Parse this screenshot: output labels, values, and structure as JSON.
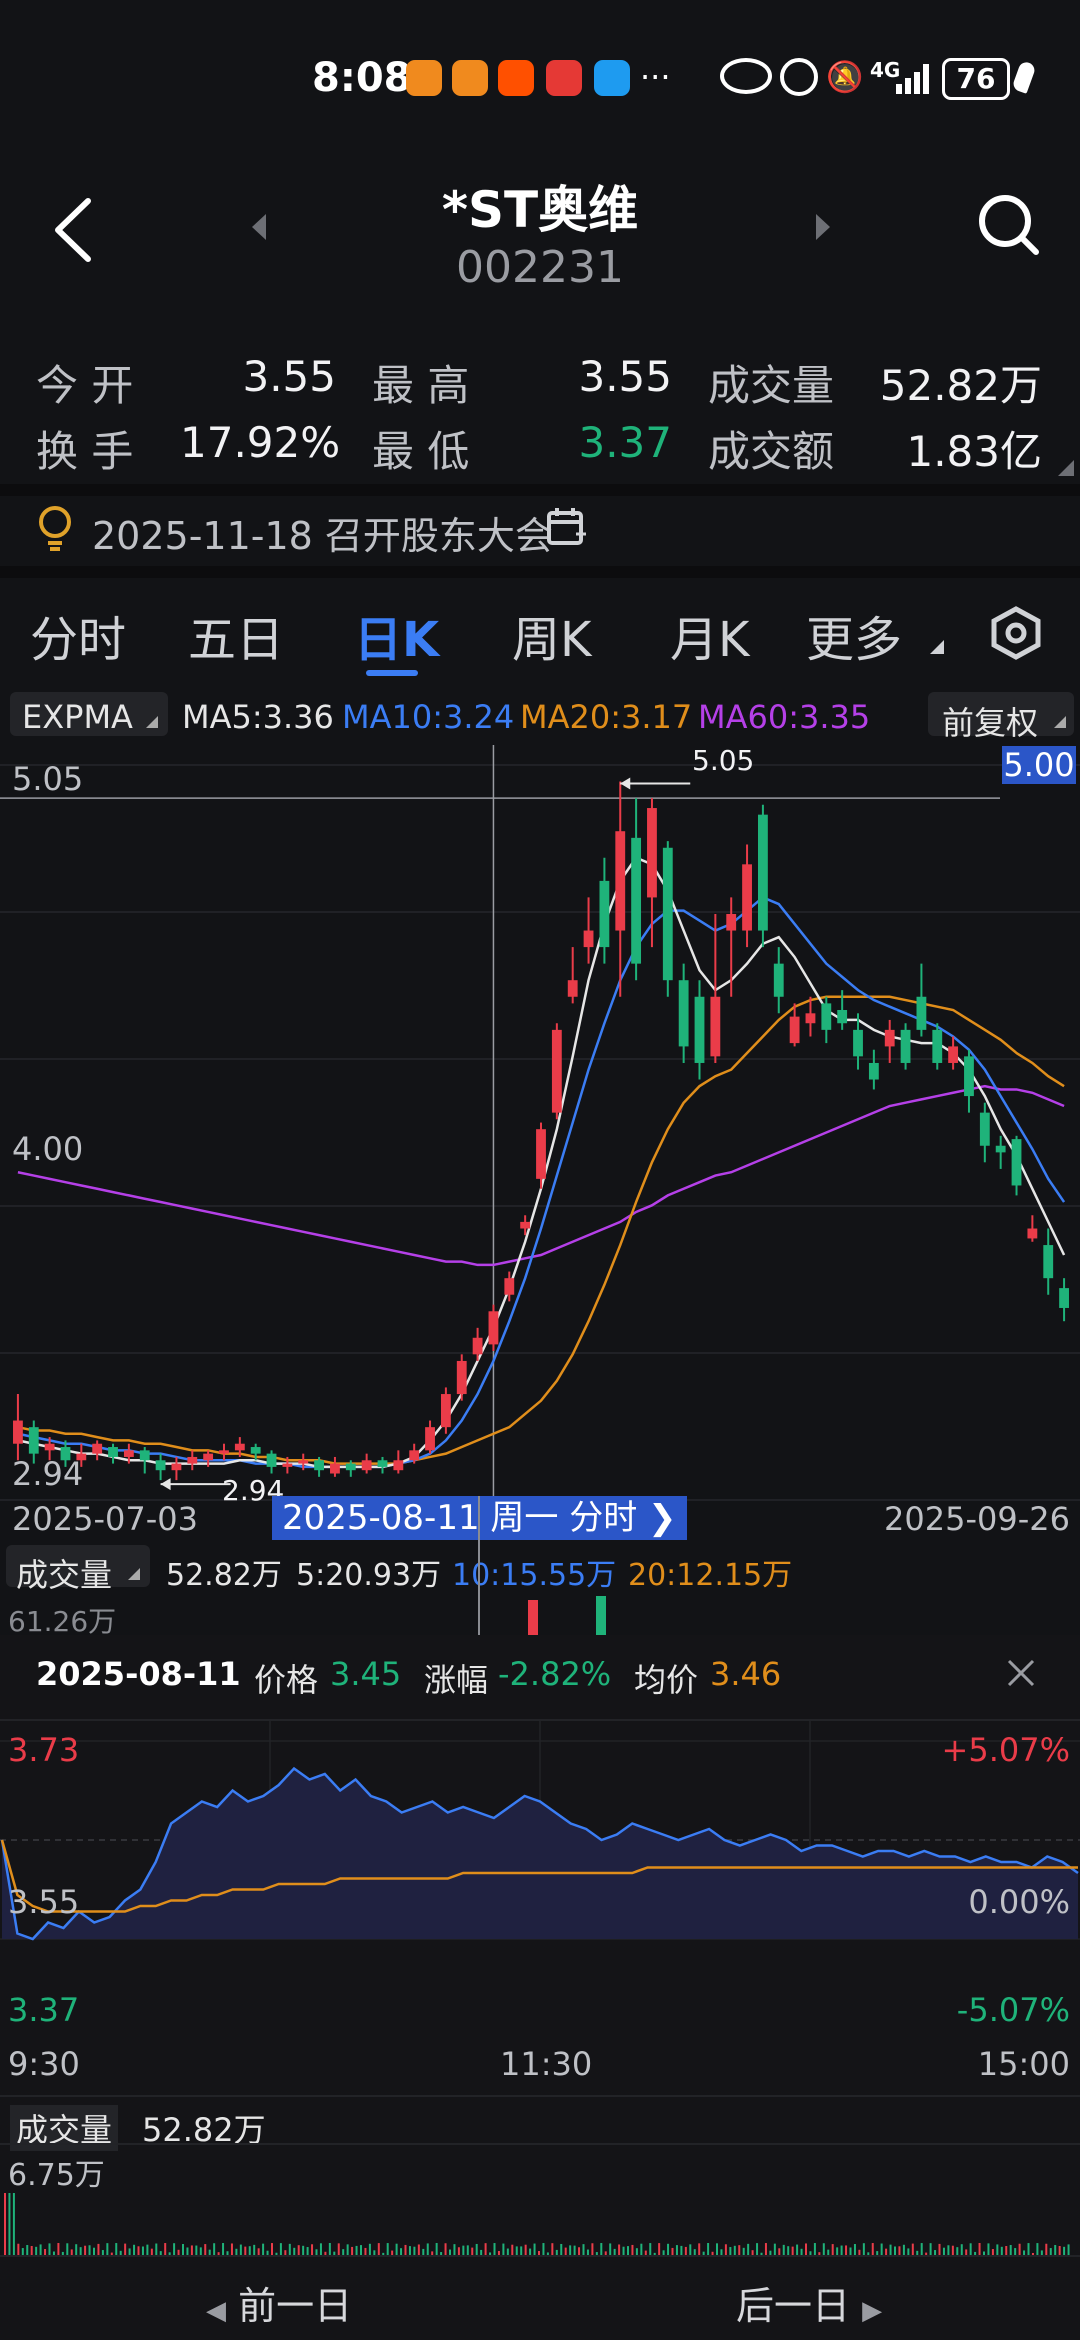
{
  "status_bar": {
    "time": "8:08",
    "more": "···",
    "network": "4G",
    "battery": "76",
    "app_icons": [
      "app-icon-orange-1",
      "app-icon-orange-2",
      "taobao-icon",
      "app-icon-red",
      "search-app-icon"
    ]
  },
  "header": {
    "name": "*ST奥维",
    "code": "002231"
  },
  "quote": {
    "open_label": "今 开",
    "open": "3.55",
    "high_label": "最 高",
    "high": "3.55",
    "volume_label": "成交量",
    "volume": "52.82万",
    "turnover_label": "换 手",
    "turnover": "17.92%",
    "low_label": "最 低",
    "low": "3.37",
    "amount_label": "成交额",
    "amount": "1.83亿"
  },
  "notice": {
    "text": "2025-11-18 召开股东大会"
  },
  "tabs": [
    "分时",
    "五日",
    "日K",
    "周K",
    "月K",
    "更多"
  ],
  "active_tab": "日K",
  "indicators": {
    "type": "EXPMA",
    "ma5": "MA5:3.36",
    "ma10": "MA10:3.24",
    "ma20": "MA20:3.17",
    "ma60": "MA60:3.35",
    "adjust": "前复权"
  },
  "colors": {
    "up": "#ea3c49",
    "down": "#1fb37a",
    "ma5": "#e6e6e6",
    "ma10": "#3b7df4",
    "ma20": "#e08e1b",
    "ma60": "#b540e8",
    "accent": "#3b7df4"
  },
  "chart_data": {
    "type": "candlestick",
    "y_max_label": "5.05",
    "y_mid_label": "4.00",
    "y_min_label": "2.94",
    "high_marker": "5.05",
    "low_marker": "2.94",
    "crosshair_price": "5.00",
    "crosshair_date": "2025-08-11 周一 分时",
    "start_date": "2025-07-03",
    "end_date": "2025-09-26",
    "ylim": [
      2.88,
      5.1
    ],
    "candles": [
      {
        "o": 3.05,
        "c": 3.12,
        "h": 3.2,
        "l": 3.0
      },
      {
        "o": 3.1,
        "c": 3.02,
        "h": 3.12,
        "l": 2.99
      },
      {
        "o": 3.03,
        "c": 3.05,
        "h": 3.07,
        "l": 3.0
      },
      {
        "o": 3.04,
        "c": 3.0,
        "h": 3.06,
        "l": 2.98
      },
      {
        "o": 3.0,
        "c": 3.02,
        "h": 3.05,
        "l": 2.98
      },
      {
        "o": 3.02,
        "c": 3.05,
        "h": 3.06,
        "l": 3.0
      },
      {
        "o": 3.04,
        "c": 3.01,
        "h": 3.05,
        "l": 2.99
      },
      {
        "o": 3.01,
        "c": 3.03,
        "h": 3.05,
        "l": 2.99
      },
      {
        "o": 3.03,
        "c": 3.0,
        "h": 3.04,
        "l": 2.96
      },
      {
        "o": 3.0,
        "c": 2.97,
        "h": 3.02,
        "l": 2.94
      },
      {
        "o": 2.97,
        "c": 2.99,
        "h": 3.01,
        "l": 2.94
      },
      {
        "o": 2.99,
        "c": 3.01,
        "h": 3.03,
        "l": 2.97
      },
      {
        "o": 3.0,
        "c": 3.02,
        "h": 3.03,
        "l": 2.98
      },
      {
        "o": 3.02,
        "c": 3.03,
        "h": 3.05,
        "l": 3.0
      },
      {
        "o": 3.03,
        "c": 3.05,
        "h": 3.07,
        "l": 3.01
      },
      {
        "o": 3.04,
        "c": 3.02,
        "h": 3.05,
        "l": 3.0
      },
      {
        "o": 3.02,
        "c": 2.98,
        "h": 3.03,
        "l": 2.96
      },
      {
        "o": 2.98,
        "c": 2.99,
        "h": 3.01,
        "l": 2.96
      },
      {
        "o": 2.99,
        "c": 3.0,
        "h": 3.02,
        "l": 2.97
      },
      {
        "o": 3.0,
        "c": 2.97,
        "h": 3.01,
        "l": 2.95
      },
      {
        "o": 2.96,
        "c": 2.99,
        "h": 3.01,
        "l": 2.95
      },
      {
        "o": 2.99,
        "c": 2.97,
        "h": 3.0,
        "l": 2.95
      },
      {
        "o": 2.97,
        "c": 3.0,
        "h": 3.02,
        "l": 2.96
      },
      {
        "o": 3.0,
        "c": 2.98,
        "h": 3.01,
        "l": 2.96
      },
      {
        "o": 2.97,
        "c": 3.0,
        "h": 3.03,
        "l": 2.96
      },
      {
        "o": 3.0,
        "c": 3.03,
        "h": 3.05,
        "l": 2.99
      },
      {
        "o": 3.03,
        "c": 3.1,
        "h": 3.12,
        "l": 3.02
      },
      {
        "o": 3.1,
        "c": 3.2,
        "h": 3.22,
        "l": 3.08
      },
      {
        "o": 3.2,
        "c": 3.3,
        "h": 3.32,
        "l": 3.18
      },
      {
        "o": 3.32,
        "c": 3.37,
        "h": 3.4,
        "l": 3.3
      },
      {
        "o": 3.35,
        "c": 3.45,
        "h": 3.47,
        "l": 3.33
      },
      {
        "o": 3.5,
        "c": 3.55,
        "h": 3.57,
        "l": 3.48
      },
      {
        "o": 3.7,
        "c": 3.72,
        "h": 3.74,
        "l": 3.68
      },
      {
        "o": 3.85,
        "c": 4.0,
        "h": 4.02,
        "l": 3.82
      },
      {
        "o": 4.05,
        "c": 4.3,
        "h": 4.32,
        "l": 4.03
      },
      {
        "o": 4.4,
        "c": 4.45,
        "h": 4.55,
        "l": 4.38
      },
      {
        "o": 4.55,
        "c": 4.6,
        "h": 4.7,
        "l": 4.5
      },
      {
        "o": 4.75,
        "c": 4.55,
        "h": 4.82,
        "l": 4.5
      },
      {
        "o": 4.6,
        "c": 4.9,
        "h": 5.05,
        "l": 4.4
      },
      {
        "o": 4.88,
        "c": 4.5,
        "h": 5.0,
        "l": 4.45
      },
      {
        "o": 4.7,
        "c": 4.97,
        "h": 5.0,
        "l": 4.55
      },
      {
        "o": 4.85,
        "c": 4.45,
        "h": 4.87,
        "l": 4.4
      },
      {
        "o": 4.45,
        "c": 4.25,
        "h": 4.5,
        "l": 4.2
      },
      {
        "o": 4.4,
        "c": 4.2,
        "h": 4.45,
        "l": 4.15
      },
      {
        "o": 4.22,
        "c": 4.4,
        "h": 4.65,
        "l": 4.2
      },
      {
        "o": 4.6,
        "c": 4.65,
        "h": 4.7,
        "l": 4.4
      },
      {
        "o": 4.6,
        "c": 4.8,
        "h": 4.86,
        "l": 4.55
      },
      {
        "o": 4.95,
        "c": 4.6,
        "h": 4.98,
        "l": 4.55
      },
      {
        "o": 4.5,
        "c": 4.4,
        "h": 4.55,
        "l": 4.35
      },
      {
        "o": 4.26,
        "c": 4.34,
        "h": 4.38,
        "l": 4.25
      },
      {
        "o": 4.32,
        "c": 4.35,
        "h": 4.4,
        "l": 4.28
      },
      {
        "o": 4.38,
        "c": 4.3,
        "h": 4.4,
        "l": 4.26
      },
      {
        "o": 4.36,
        "c": 4.32,
        "h": 4.42,
        "l": 4.3
      },
      {
        "o": 4.3,
        "c": 4.22,
        "h": 4.35,
        "l": 4.18
      },
      {
        "o": 4.2,
        "c": 4.15,
        "h": 4.24,
        "l": 4.12
      },
      {
        "o": 4.25,
        "c": 4.3,
        "h": 4.33,
        "l": 4.2
      },
      {
        "o": 4.3,
        "c": 4.2,
        "h": 4.32,
        "l": 4.18
      },
      {
        "o": 4.4,
        "c": 4.3,
        "h": 4.5,
        "l": 4.28
      },
      {
        "o": 4.3,
        "c": 4.2,
        "h": 4.32,
        "l": 4.18
      },
      {
        "o": 4.2,
        "c": 4.25,
        "h": 4.28,
        "l": 4.18
      },
      {
        "o": 4.22,
        "c": 4.1,
        "h": 4.24,
        "l": 4.05
      },
      {
        "o": 4.05,
        "c": 3.95,
        "h": 4.08,
        "l": 3.9
      },
      {
        "o": 3.95,
        "c": 3.93,
        "h": 3.98,
        "l": 3.88
      },
      {
        "o": 3.97,
        "c": 3.83,
        "h": 3.98,
        "l": 3.8
      },
      {
        "o": 3.67,
        "c": 3.7,
        "h": 3.74,
        "l": 3.66
      },
      {
        "o": 3.65,
        "c": 3.55,
        "h": 3.7,
        "l": 3.5
      },
      {
        "o": 3.52,
        "c": 3.46,
        "h": 3.55,
        "l": 3.42
      }
    ],
    "ma60": [
      3.87,
      3.86,
      3.85,
      3.84,
      3.83,
      3.82,
      3.81,
      3.8,
      3.79,
      3.78,
      3.77,
      3.76,
      3.75,
      3.74,
      3.73,
      3.72,
      3.71,
      3.7,
      3.69,
      3.68,
      3.67,
      3.66,
      3.65,
      3.64,
      3.63,
      3.62,
      3.61,
      3.6,
      3.6,
      3.59,
      3.59,
      3.6,
      3.61,
      3.62,
      3.64,
      3.66,
      3.68,
      3.7,
      3.72,
      3.75,
      3.77,
      3.8,
      3.82,
      3.84,
      3.86,
      3.87,
      3.89,
      3.91,
      3.93,
      3.95,
      3.97,
      3.99,
      4.01,
      4.03,
      4.05,
      4.07,
      4.08,
      4.09,
      4.1,
      4.11,
      4.12,
      4.13,
      4.12,
      4.12,
      4.11,
      4.09,
      4.07
    ],
    "ma20": [
      3.1,
      3.09,
      3.09,
      3.08,
      3.08,
      3.07,
      3.06,
      3.06,
      3.05,
      3.05,
      3.04,
      3.03,
      3.03,
      3.02,
      3.02,
      3.01,
      3.01,
      3.0,
      3.0,
      3.0,
      2.99,
      2.99,
      2.99,
      2.99,
      2.99,
      3.0,
      3.01,
      3.02,
      3.04,
      3.06,
      3.08,
      3.1,
      3.14,
      3.18,
      3.24,
      3.32,
      3.42,
      3.53,
      3.65,
      3.78,
      3.9,
      4.0,
      4.08,
      4.13,
      4.16,
      4.18,
      4.23,
      4.28,
      4.33,
      4.37,
      4.39,
      4.4,
      4.4,
      4.4,
      4.4,
      4.4,
      4.39,
      4.38,
      4.37,
      4.36,
      4.33,
      4.3,
      4.27,
      4.23,
      4.2,
      4.16,
      4.13
    ],
    "ma10": [
      3.08,
      3.07,
      3.06,
      3.05,
      3.05,
      3.04,
      3.03,
      3.03,
      3.02,
      3.02,
      3.01,
      3.0,
      3.0,
      3.0,
      3.0,
      2.99,
      2.99,
      2.99,
      2.98,
      2.98,
      2.98,
      2.98,
      2.98,
      2.98,
      2.99,
      3.0,
      3.02,
      3.06,
      3.12,
      3.2,
      3.3,
      3.42,
      3.55,
      3.7,
      3.86,
      4.02,
      4.18,
      4.32,
      4.45,
      4.55,
      4.62,
      4.66,
      4.66,
      4.63,
      4.6,
      4.62,
      4.66,
      4.7,
      4.68,
      4.62,
      4.56,
      4.5,
      4.46,
      4.42,
      4.39,
      4.37,
      4.35,
      4.33,
      4.31,
      4.28,
      4.24,
      4.18,
      4.1,
      4.02,
      3.94,
      3.85,
      3.78
    ],
    "ma5": [
      3.06,
      3.05,
      3.04,
      3.03,
      3.02,
      3.02,
      3.01,
      3.0,
      3.0,
      2.99,
      2.99,
      2.99,
      2.99,
      2.99,
      3.0,
      3.0,
      2.99,
      2.99,
      2.99,
      2.98,
      2.98,
      2.98,
      2.98,
      2.98,
      2.99,
      3.01,
      3.06,
      3.12,
      3.2,
      3.3,
      3.4,
      3.52,
      3.66,
      3.82,
      4.0,
      4.22,
      4.45,
      4.62,
      4.75,
      4.82,
      4.8,
      4.72,
      4.6,
      4.48,
      4.42,
      4.45,
      4.5,
      4.56,
      4.58,
      4.52,
      4.44,
      4.36,
      4.33,
      4.33,
      4.3,
      4.28,
      4.27,
      4.26,
      4.26,
      4.23,
      4.18,
      4.1,
      4.0,
      3.92,
      3.82,
      3.72,
      3.62
    ]
  },
  "volume_bar": {
    "label": "成交量",
    "total": "52.82万",
    "ma5": "5:20.93万",
    "ma10": "10:15.55万",
    "ma20": "20:12.15万",
    "axis_max": "61.26万"
  },
  "intraday": {
    "date": "2025-08-11",
    "price_label": "价格",
    "price": "3.45",
    "change_label": "涨幅",
    "change": "-2.82%",
    "avg_label": "均价",
    "avg": "3.46",
    "y_top": "3.73",
    "y_mid": "3.55",
    "y_bot": "3.37",
    "pct_top": "+5.07%",
    "pct_mid": "0.00%",
    "pct_bot": "-5.07%",
    "t_open": "9:30",
    "t_mid": "11:30",
    "t_close": "15:00",
    "vol_label": "成交量",
    "vol_total": "52.82万",
    "vol_max": "6.75万",
    "prices": [
      3.55,
      3.38,
      3.37,
      3.4,
      3.39,
      3.42,
      3.4,
      3.41,
      3.44,
      3.46,
      3.51,
      3.58,
      3.6,
      3.62,
      3.61,
      3.64,
      3.62,
      3.63,
      3.65,
      3.68,
      3.66,
      3.67,
      3.64,
      3.66,
      3.63,
      3.62,
      3.6,
      3.61,
      3.62,
      3.6,
      3.61,
      3.6,
      3.59,
      3.61,
      3.63,
      3.62,
      3.6,
      3.58,
      3.57,
      3.55,
      3.56,
      3.58,
      3.57,
      3.56,
      3.55,
      3.56,
      3.57,
      3.55,
      3.54,
      3.55,
      3.56,
      3.55,
      3.53,
      3.54,
      3.54,
      3.53,
      3.52,
      3.53,
      3.53,
      3.52,
      3.53,
      3.52,
      3.52,
      3.51,
      3.52,
      3.51,
      3.51,
      3.5,
      3.52,
      3.51,
      3.49
    ],
    "avgs": [
      3.55,
      3.45,
      3.43,
      3.42,
      3.42,
      3.42,
      3.42,
      3.42,
      3.42,
      3.43,
      3.43,
      3.44,
      3.44,
      3.45,
      3.45,
      3.46,
      3.46,
      3.46,
      3.47,
      3.47,
      3.47,
      3.47,
      3.48,
      3.48,
      3.48,
      3.48,
      3.48,
      3.48,
      3.48,
      3.48,
      3.49,
      3.49,
      3.49,
      3.49,
      3.49,
      3.49,
      3.49,
      3.49,
      3.49,
      3.49,
      3.49,
      3.49,
      3.5,
      3.5,
      3.5,
      3.5,
      3.5,
      3.5,
      3.5,
      3.5,
      3.5,
      3.5,
      3.5,
      3.5,
      3.5,
      3.5,
      3.5,
      3.5,
      3.5,
      3.5,
      3.5,
      3.5,
      3.5,
      3.5,
      3.5,
      3.5,
      3.5,
      3.5,
      3.5,
      3.5,
      3.5
    ]
  },
  "footer": {
    "prev": "前一日",
    "next": "后一日"
  }
}
